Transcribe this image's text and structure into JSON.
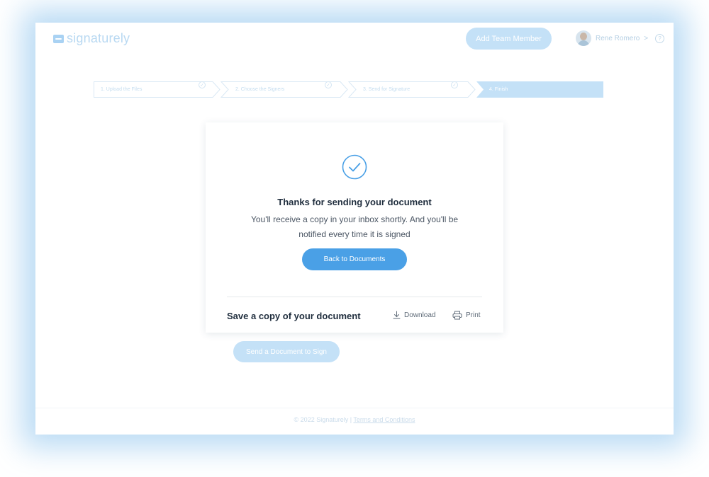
{
  "header": {
    "brand": "signaturely",
    "add_team_label": "Add Team Member",
    "user_name": "Rene Romero",
    "user_chevron": ">",
    "help_glyph": "?"
  },
  "stepper": {
    "steps": [
      {
        "label": "1.  Upload the Files",
        "state": "done"
      },
      {
        "label": "2.  Choose the Signers",
        "state": "done"
      },
      {
        "label": "3.  Send for Signature",
        "state": "done"
      },
      {
        "label": "4.  Finish",
        "state": "active"
      }
    ]
  },
  "card": {
    "icon": "check-circle-icon",
    "title": "Thanks for sending your document",
    "message": "You'll receive a copy in your inbox shortly. And you'll be notified every time it is signed",
    "back_label": "Back to Documents",
    "save_label": "Save a copy of your document",
    "download_label": "Download",
    "print_label": "Print"
  },
  "background": {
    "send_label": "Send a Document to Sign"
  },
  "footer": {
    "copyright": "© 2022 Signaturely | ",
    "terms_label": "Terms and Conditions"
  },
  "colors": {
    "accent": "#4aa0e6",
    "muted_accent": "#c4e1f7",
    "title": "#1f2d3d",
    "glow": "#a0cdf0"
  }
}
